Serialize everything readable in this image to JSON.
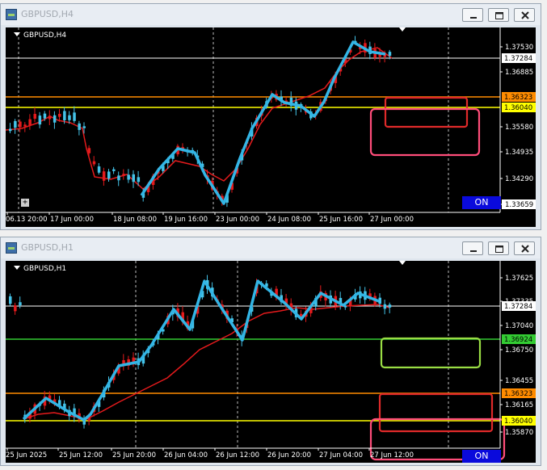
{
  "windows": [
    {
      "title": "GBPUSD,H4",
      "symbol_label": "GBPUSD,H4",
      "on_label": "ON",
      "price_labels": [
        "1.37530",
        "1.36885",
        "1.35580",
        "1.34935",
        "1.34290",
        "1.33659"
      ],
      "highlight_labels": [
        {
          "text": "1.37284",
          "bg": "#ffffff",
          "fg": "#000000"
        },
        {
          "text": "1.36323",
          "bg": "#ff8c00",
          "fg": "#000000"
        },
        {
          "text": "1.36040",
          "bg": "#ffff00",
          "fg": "#000000"
        }
      ],
      "time_labels": [
        "06.13 20:00",
        "17 Jun 00:00",
        "18 Jun 08:00",
        "19 Jun 16:00",
        "23 Jun 00:00",
        "24 Jun 08:00",
        "25 Jun 16:00",
        "27 Jun 00:00"
      ],
      "colors": {
        "orange_line": "#ff8c00",
        "yellow_line": "#ffff00",
        "zone_red": "#e02a2a",
        "zone_pink": "#ff4d7a",
        "ma": "#e41a1c",
        "bull": "#44c3e8",
        "bear": "#e41a1c",
        "zigzag": "#33b5e5"
      }
    },
    {
      "title": "GBPUSD,H1",
      "symbol_label": "GBPUSD,H1",
      "on_label": "ON",
      "price_labels": [
        "1.37625",
        "1.37335",
        "1.37040",
        "1.36750",
        "1.36455",
        "1.36165",
        "1.35870"
      ],
      "highlight_labels": [
        {
          "text": "1.37284",
          "bg": "#ffffff",
          "fg": "#000000"
        },
        {
          "text": "1.36924",
          "bg": "#33cc33",
          "fg": "#000000"
        },
        {
          "text": "1.36323",
          "bg": "#ff8c00",
          "fg": "#000000"
        },
        {
          "text": "1.36040",
          "bg": "#ffff00",
          "fg": "#000000"
        }
      ],
      "time_labels": [
        "25 Jun 2025",
        "25 Jun 12:00",
        "25 Jun 20:00",
        "26 Jun 04:00",
        "26 Jun 12:00",
        "26 Jun 20:00",
        "27 Jun 04:00",
        "27 Jun 12:00"
      ],
      "colors": {
        "green_line": "#33cc33",
        "orange_line": "#ff8c00",
        "yellow_line": "#ffff00",
        "zone_green": "#99dd44",
        "zone_red": "#e02a2a",
        "zone_pink": "#ff4d7a",
        "ma": "#e41a1c",
        "bull": "#44c3e8",
        "bear": "#e41a1c",
        "zigzag": "#33b5e5"
      }
    }
  ]
}
